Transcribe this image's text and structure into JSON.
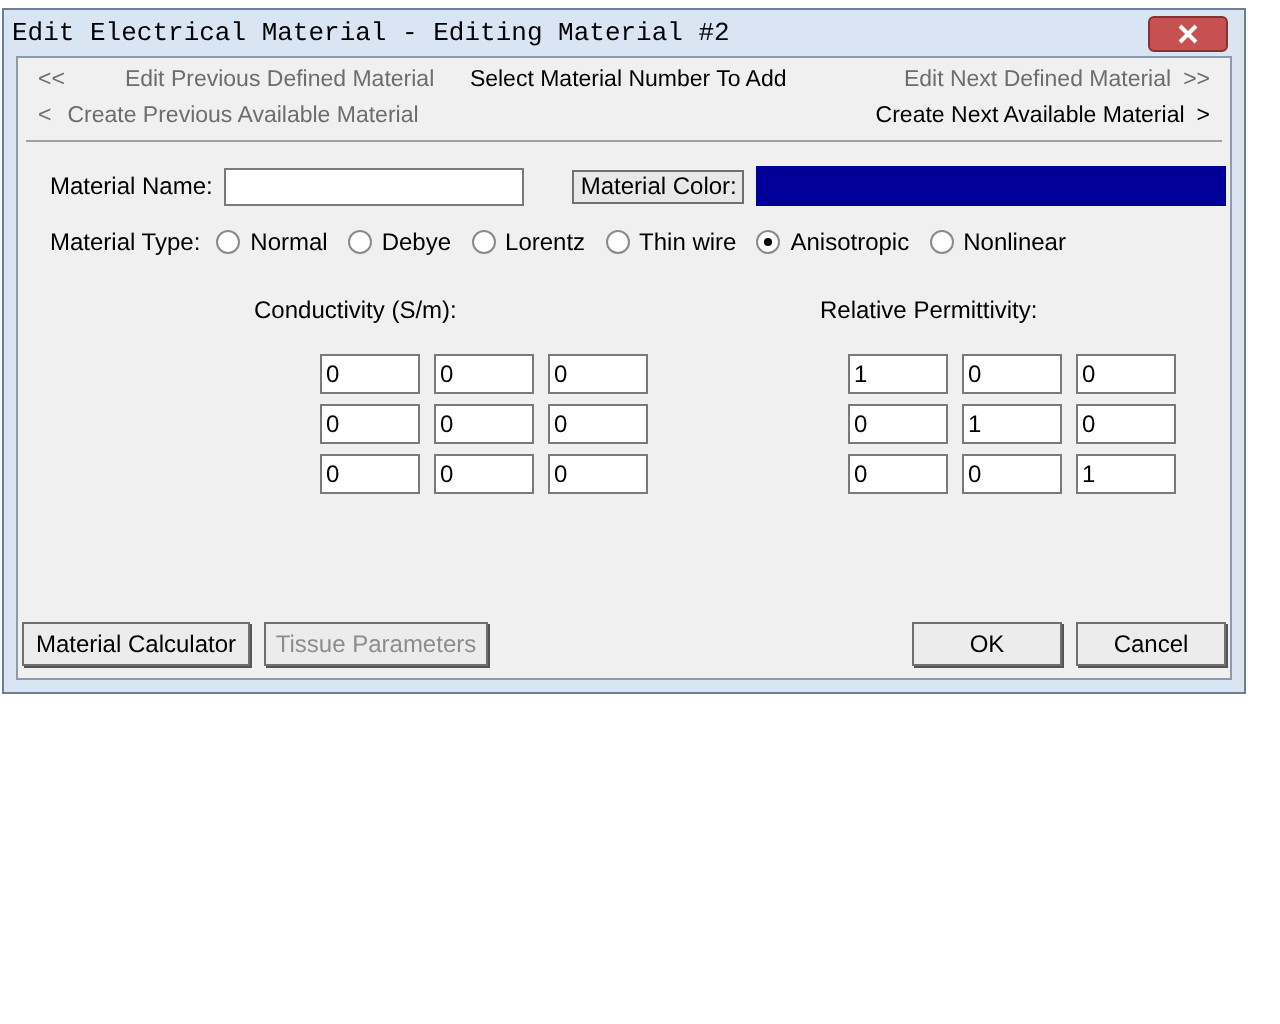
{
  "window": {
    "title": "Edit Electrical Material - Editing Material #2"
  },
  "nav": {
    "prev_defined": {
      "arrow": "<<",
      "label": "Edit Previous Defined Material",
      "disabled": true
    },
    "select": {
      "label": "Select Material Number To Add",
      "disabled": false
    },
    "next_defined": {
      "label": "Edit Next Defined Material",
      "arrow": ">>",
      "disabled": true
    },
    "prev_available": {
      "arrow": "<",
      "label": "Create Previous Available Material",
      "disabled": true
    },
    "next_available": {
      "label": "Create Next Available Material",
      "arrow": ">",
      "disabled": false
    }
  },
  "name": {
    "label": "Material Name:"
  },
  "color": {
    "button": "Material Color:",
    "color": "#000099"
  },
  "type": {
    "label": "Material Type:",
    "options": [
      {
        "label": "Normal",
        "selected": false
      },
      {
        "label": "Debye",
        "selected": false
      },
      {
        "label": "Lorentz",
        "selected": false
      },
      {
        "label": "Thin wire",
        "selected": false
      },
      {
        "label": "Anisotropic",
        "selected": true
      },
      {
        "label": "Nonlinear",
        "selected": false
      }
    ]
  },
  "matrices": [
    {
      "title": "Conductivity (S/m):",
      "rows": [
        [
          "0",
          "0",
          "0"
        ],
        [
          "0",
          "0",
          "0"
        ],
        [
          "0",
          "0",
          "0"
        ]
      ]
    },
    {
      "title": "Relative Permittivity:",
      "rows": [
        [
          "1",
          "0",
          "0"
        ],
        [
          "0",
          "1",
          "0"
        ],
        [
          "0",
          "0",
          "1"
        ]
      ]
    }
  ],
  "left_buttons": [
    {
      "label": "Material Calculator",
      "disabled": false
    },
    {
      "label": "Tissue Parameters",
      "disabled": true
    }
  ],
  "right_buttons": [
    {
      "label": "OK",
      "disabled": false
    },
    {
      "label": "Cancel",
      "disabled": false
    }
  ]
}
